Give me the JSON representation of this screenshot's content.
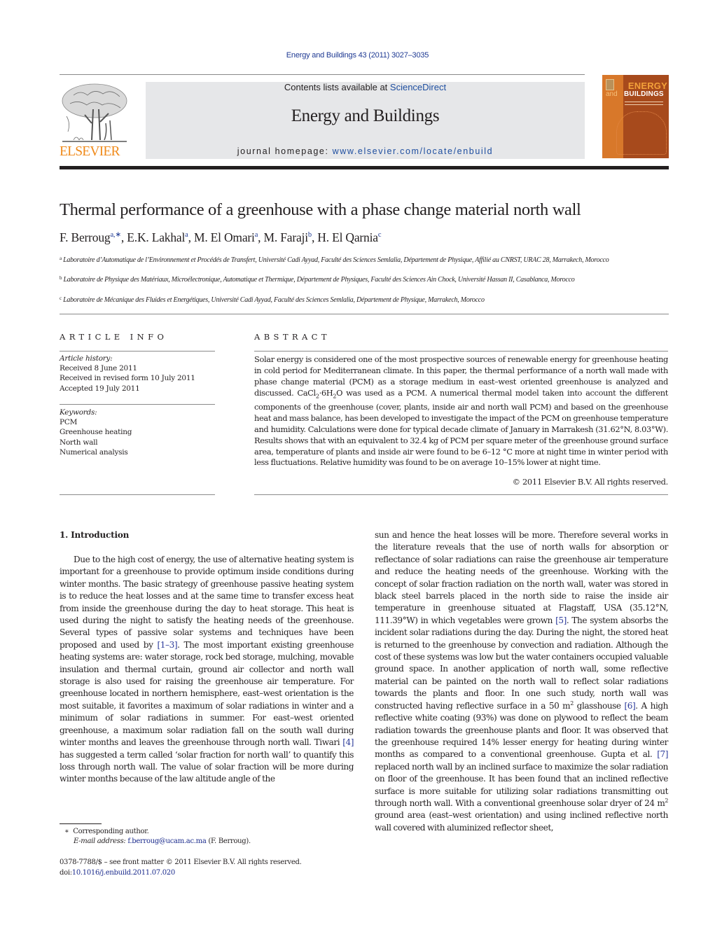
{
  "header": {
    "journal_reference": "Energy and Buildings 43 (2011) 3027–3035",
    "publisher_logo_text": "ELSEVIER",
    "contents_prefix": "Contents lists available at ",
    "contents_link": "ScienceDirect",
    "journal_name": "Energy and Buildings",
    "homepage_prefix": "journal homepage: ",
    "homepage_url": "www.elsevier.com/locate/enbuild",
    "cover": {
      "title_line1": "ENERGY",
      "title_line2_prefix": "and",
      "title_line2": "BUILDINGS"
    },
    "colors": {
      "elsevier_orange": "#f08a1a",
      "link_blue": "#1f4fa0",
      "banner_gray": "#e6e7e9",
      "cover_brown": "#a74a1c"
    }
  },
  "article": {
    "title": "Thermal performance of a greenhouse with a phase change material north wall",
    "authors": [
      {
        "name": "F. Berroug",
        "sup": "a,∗"
      },
      {
        "name": "E.K. Lakhal",
        "sup": "a"
      },
      {
        "name": "M. El Omari",
        "sup": "a"
      },
      {
        "name": "M. Faraji",
        "sup": "b"
      },
      {
        "name": "H. El Qarnia",
        "sup": "c"
      }
    ],
    "affiliations": [
      {
        "label": "a",
        "text": "Laboratoire d’Automatique de l’Environnement et Procédés de Transfert, Université Cadi Ayyad, Faculté des Sciences Semlalia, Département de Physique, Affilié au CNRST, URAC 28, Marrakech, Morocco"
      },
      {
        "label": "b",
        "text": "Laboratoire de Physique des Matériaux, Microélectronique, Automatique et Thermique, Département de Physiques, Faculté des Sciences Ain Chock, Université Hassan II, Casablanca, Morocco"
      },
      {
        "label": "c",
        "text": "Laboratoire de Mécanique des Fluides et Energétiques, Université Cadi Ayyad, Faculté des Sciences Semlalia, Département de Physique, Marrakech, Morocco"
      }
    ]
  },
  "article_info": {
    "heading": "ARTICLE INFO",
    "history_label": "Article history:",
    "history": [
      "Received 8 June 2011",
      "Received in revised form 10 July 2011",
      "Accepted 19 July 2011"
    ],
    "keywords_label": "Keywords:",
    "keywords": [
      "PCM",
      "Greenhouse heating",
      "North wall",
      "Numerical analysis"
    ]
  },
  "abstract": {
    "heading": "ABSTRACT",
    "part1": "Solar energy is considered one of the most prospective sources of renewable energy for greenhouse heating in cold period for Mediterranean climate. In this paper, the thermal performance of a north wall made with phase change material (PCM) as a storage medium in east–west oriented greenhouse is analyzed and discussed. ",
    "formula_a": "CaCl",
    "formula_sub1": "2",
    "formula_b": "·6H",
    "formula_sub2": "2",
    "formula_c": "O",
    "part2": " was used as a PCM. A numerical thermal model taken into account the different components of the greenhouse (cover, plants, inside air and north wall PCM) and based on the greenhouse heat and mass balance, has been developed to investigate the impact of the PCM on greenhouse temperature and humidity. Calculations were done for typical decade climate of January in Marrakesh (31.62°N, 8.03°W). Results shows that with an equivalent to 32.4 kg of PCM per square meter of the greenhouse ground surface area, temperature of plants and inside air were found to be 6–12 °C more at night time in winter period with less fluctuations. Relative humidity was found to be on average 10–15% lower at night time.",
    "copyright": "© 2011 Elsevier B.V. All rights reserved."
  },
  "introduction": {
    "heading": "1.  Introduction",
    "left": {
      "t1": "Due to the high cost of energy, the use of alternative heating system is important for a greenhouse to provide optimum inside conditions during winter months. The basic strategy of greenhouse passive heating system is to reduce the heat losses and at the same time to transfer excess heat from inside the greenhouse during the day to heat storage. This heat is used during the night to satisfy the heating needs of the greenhouse. Several types of passive solar systems and techniques have been proposed and used by ",
      "c1": "[1–3]",
      "t2": ". The most important existing greenhouse heating systems are: water storage, rock bed storage, mulching, movable insulation and thermal curtain, ground air collector and north wall storage is also used for raising the greenhouse air temperature. For greenhouse located in northern hemisphere, east–west orientation is the most suitable, it favorites a maximum of solar radiations in winter and a minimum of solar radiations in summer. For east–west oriented greenhouse, a maximum solar radiation fall on the south wall during winter months and leaves the greenhouse through north wall. Tiwari ",
      "c2": "[4]",
      "t3": " has suggested a term called ‘solar fraction for north wall’ to quantify this loss through north wall. The value of solar fraction will be more during winter months because of the law altitude angle of the"
    },
    "right": {
      "t1": "sun and hence the heat losses will be more. Therefore several works in the literature reveals that the use of north walls for absorption or reflectance of solar radiations can raise the greenhouse air temperature and reduce the heating needs of the greenhouse. Working with the concept of solar fraction radiation on the north wall, water was stored in black steel barrels placed in the north side to raise the inside air temperature in greenhouse situated at Flagstaff, USA (35.12°N, 111.39°W) in which vegetables were grown ",
      "c1": "[5]",
      "t2": ". The system absorbs the incident solar radiations during the day. During the night, the stored heat is returned to the greenhouse by convection and radiation. Although the cost of these systems was low but the water containers occupied valuable ground space. In another application of north wall, some reflective material can be painted on the north wall to reflect solar radiations towards the plants and floor. In one such study, north wall was constructed having reflective surface in a 50 m",
      "sup1": "2",
      "t3": " glasshouse ",
      "c2": "[6]",
      "t4": ". A high reflective white coating (93%) was done on plywood to reflect the beam radiation towards the greenhouse plants and floor. It was observed that the greenhouse required 14% lesser energy for heating during winter months as compared to a conventional greenhouse. Gupta et al. ",
      "c3": "[7]",
      "t5": " replaced north wall by an inclined surface to maximize the solar radiation on floor of the greenhouse. It has been found that an inclined reflective surface is more suitable for utilizing solar radiations transmitting out through north wall. With a conventional greenhouse solar dryer of 24 m",
      "sup2": "2",
      "t6": " ground area (east–west orientation) and using inclined reflective north wall covered with aluminized reflector sheet,"
    }
  },
  "footnotes": {
    "star": "∗",
    "corresponding": "Corresponding author.",
    "email_label": "E-mail address:",
    "email": "f.berroug@ucam.ac.ma",
    "email_suffix": " (F. Berroug).",
    "front_matter": "0378-7788/$ – see front matter © 2011 Elsevier B.V. All rights reserved.",
    "doi_prefix": "doi:",
    "doi": "10.1016/j.enbuild.2011.07.020"
  }
}
